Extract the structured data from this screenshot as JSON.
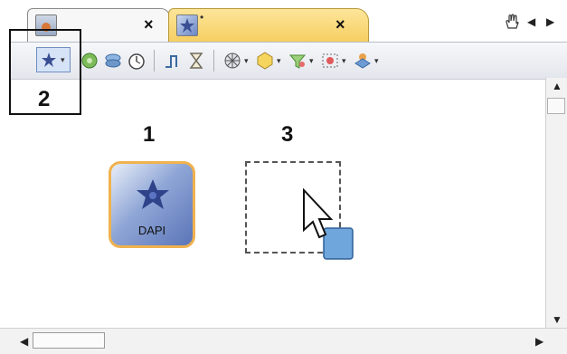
{
  "tabs": [
    {
      "icon": "document-icon",
      "close_label": "×"
    },
    {
      "icon": "dapi-star-icon",
      "dirty_marker": "•",
      "close_label": "×"
    }
  ],
  "tab_controls": {
    "hand_icon": "hand-icon",
    "prev_icon": "chevron-left-icon",
    "next_icon": "chevron-right-icon"
  },
  "toolbar": {
    "tools": [
      "dapi-star-icon",
      "channel-icon",
      "layers-icon",
      "timer-icon",
      "step-icon",
      "hourglass-icon",
      "radial-icon",
      "shape-icon",
      "filter-icon",
      "measure-icon",
      "overlay-icon"
    ],
    "dropdown_caret": "▾"
  },
  "callouts": {
    "one": "1",
    "two": "2",
    "three": "3"
  },
  "canvas": {
    "dapi_tile": {
      "label": "DAPI",
      "icon": "dapi-star-icon"
    },
    "drop_target_icon": "cursor-drag-icon"
  },
  "colors": {
    "accent_tab": "#f6cf62",
    "tile_border": "#f0b24e",
    "tile_fill": "#5b75b8"
  }
}
